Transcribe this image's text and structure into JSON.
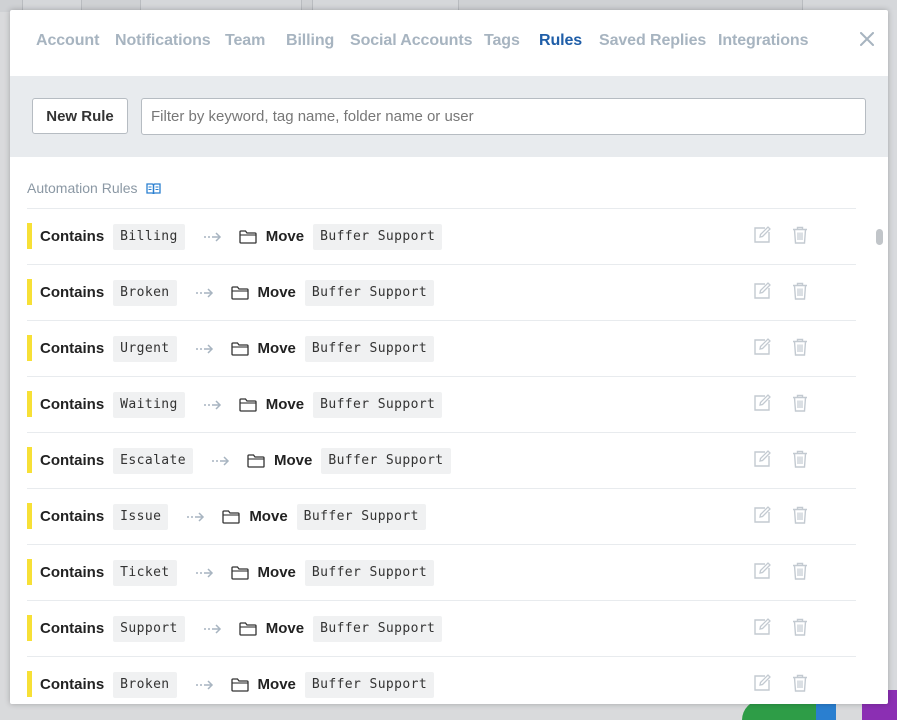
{
  "tabs": [
    {
      "label": "Account",
      "active": false
    },
    {
      "label": "Notifications",
      "active": false
    },
    {
      "label": "Team",
      "active": false
    },
    {
      "label": "Billing",
      "active": false
    },
    {
      "label": "Social Accounts",
      "active": false
    },
    {
      "label": "Tags",
      "active": false
    },
    {
      "label": "Rules",
      "active": true
    },
    {
      "label": "Saved Replies",
      "active": false
    },
    {
      "label": "Integrations",
      "active": false
    }
  ],
  "toolbar": {
    "new_rule_label": "New Rule",
    "filter_placeholder": "Filter by keyword, tag name, folder name or user",
    "filter_value": ""
  },
  "section": {
    "title": "Automation Rules",
    "icon": "book-icon"
  },
  "rules": [
    {
      "condition": "Contains",
      "keyword": "Billing",
      "action": "Move",
      "folder": "Buffer Support"
    },
    {
      "condition": "Contains",
      "keyword": "Broken",
      "action": "Move",
      "folder": "Buffer Support"
    },
    {
      "condition": "Contains",
      "keyword": "Urgent",
      "action": "Move",
      "folder": "Buffer Support"
    },
    {
      "condition": "Contains",
      "keyword": "Waiting",
      "action": "Move",
      "folder": "Buffer Support"
    },
    {
      "condition": "Contains",
      "keyword": "Escalate",
      "action": "Move",
      "folder": "Buffer Support"
    },
    {
      "condition": "Contains",
      "keyword": "Issue",
      "action": "Move",
      "folder": "Buffer Support"
    },
    {
      "condition": "Contains",
      "keyword": "Ticket",
      "action": "Move",
      "folder": "Buffer Support"
    },
    {
      "condition": "Contains",
      "keyword": "Support",
      "action": "Move",
      "folder": "Buffer Support"
    },
    {
      "condition": "Contains",
      "keyword": "Broken",
      "action": "Move",
      "folder": "Buffer Support"
    }
  ],
  "colors": {
    "active_tab": "#1f5ea8",
    "inactive_tab": "#a7b4c0",
    "rule_marker": "#f7e036",
    "toolbar_bg": "#e8ebee"
  }
}
